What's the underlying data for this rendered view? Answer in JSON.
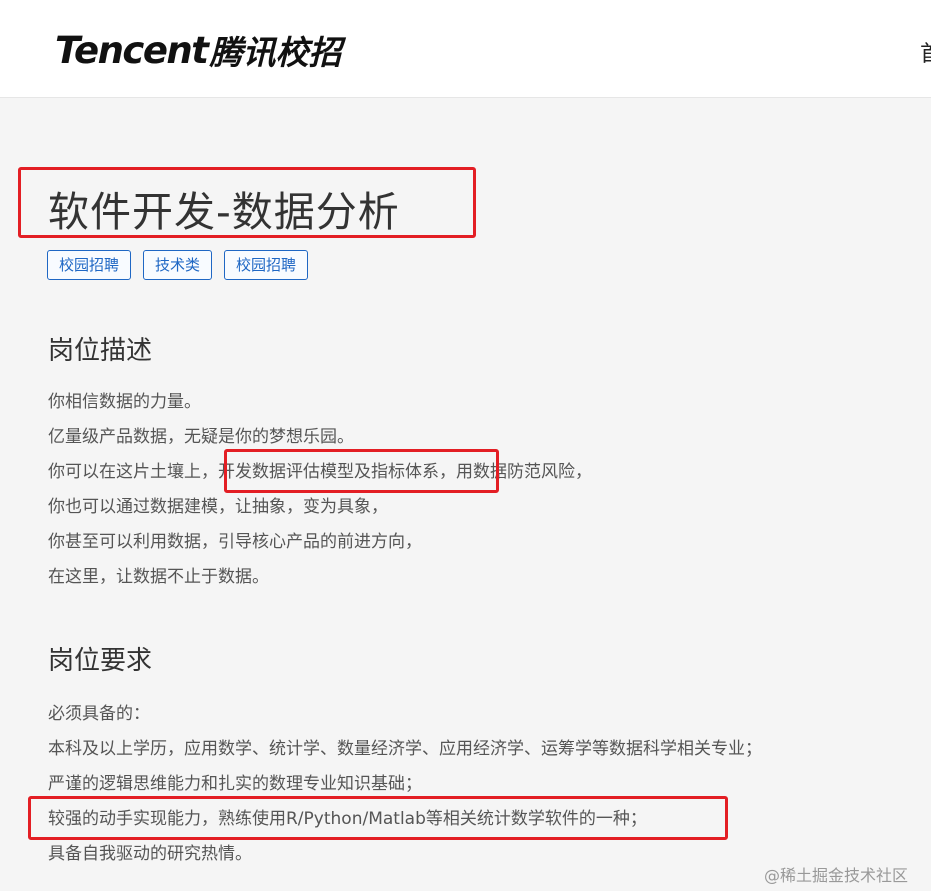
{
  "header": {
    "logo_en": "Tencent",
    "logo_cn": "腾讯校招",
    "nav_first_char": "首"
  },
  "job": {
    "title": "软件开发-数据分析",
    "tags": [
      "校园招聘",
      "技术类",
      "校园招聘"
    ]
  },
  "description": {
    "heading": "岗位描述",
    "lines": [
      "你相信数据的力量。",
      "亿量级产品数据，无疑是你的梦想乐园。",
      "你可以在这片土壤上，开发数据评估模型及指标体系，用数据防范风险，",
      "你也可以通过数据建模，让抽象，变为具象，",
      "你甚至可以利用数据，引导核心产品的前进方向，",
      "在这里，让数据不止于数据。"
    ]
  },
  "requirements": {
    "heading": "岗位要求",
    "lines": [
      "必须具备的：",
      "本科及以上学历，应用数学、统计学、数量经济学、应用经济学、运筹学等数据科学相关专业；",
      "严谨的逻辑思维能力和扎实的数理专业知识基础；",
      "较强的动手实现能力，熟练使用R/Python/Matlab等相关统计数学软件的一种；",
      "具备自我驱动的研究热情。"
    ]
  },
  "watermark": "@稀土掘金技术社区",
  "colors": {
    "highlight": "#e31e24",
    "tag": "#1f67c4",
    "background": "#f5f5f5"
  }
}
